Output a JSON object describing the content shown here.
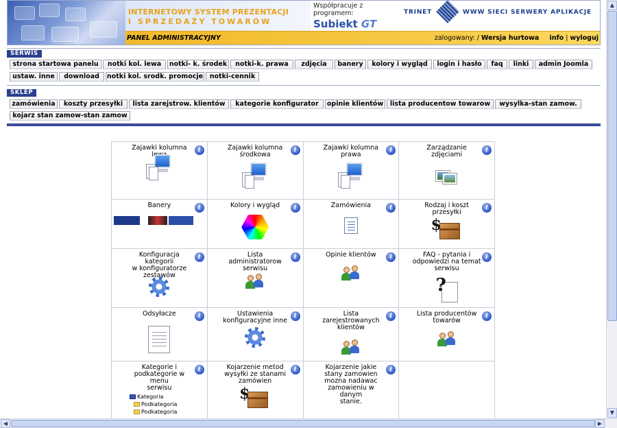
{
  "header": {
    "banner_line1": "INTERNETOWY SYSTEM PREZENTACJI",
    "banner_line2": "I SPRZEDAŻY TOWARÓW",
    "cooperates_line1": "Współpracuje z",
    "cooperates_line2": "programem:",
    "cooperates_logo": "Subiekt",
    "cooperates_logo_suffix": "GT",
    "trinet_left": "TRINET",
    "trinet_right": "WWW SIECI SERWERY APLIKACJE",
    "panel_label": "PANEL ADMINISTRACYJNY",
    "logged_label": "zalogowany: /",
    "logged_user": "Wersja hurtowa",
    "info_link": "info",
    "separator": "|",
    "logout_link": "wyloguj"
  },
  "serwis": {
    "title": "SERWIS",
    "row1": [
      "strona startowa panelu",
      "notki kol. lewa",
      "notki- k. środek",
      "notki-k. prawa",
      "zdjęcia",
      "banery",
      "kolory i wygląd",
      "login i hasło",
      "faq",
      "linki",
      "admin Joomla"
    ],
    "row2": [
      "ustaw. inne",
      "download",
      "notki kol. srodk. promocje",
      "notki-cennik"
    ]
  },
  "sklep": {
    "title": "SKLEP",
    "row1": [
      "zamówienia",
      "koszty przesyłki",
      "lista zarejstrow. klientów",
      "kategorie konfigurator",
      "opinie klientów",
      "lista producentow towarow",
      "wysylka-stan zamow."
    ],
    "row2": [
      "kojarz stan zamow-stan zamow"
    ]
  },
  "grid": {
    "info_glyph": "i",
    "cells": [
      {
        "title": "Zajawki kolumna lewa",
        "icon": "monitor-documents-icon"
      },
      {
        "title": "Zajawki kolumna\nśrodkowa",
        "icon": "monitor-documents-icon"
      },
      {
        "title": "Zajawki kolumna\nprawa",
        "icon": "monitor-documents-icon"
      },
      {
        "title": "Zarządzanie\nzdjęciami",
        "icon": "photos-icon"
      },
      {
        "title": "Banery",
        "icon": "banners-icon"
      },
      {
        "title": "Kolory i wygląd",
        "icon": "color-hexagon-icon"
      },
      {
        "title": "Zamówienia",
        "icon": "document-icon"
      },
      {
        "title": "Rodzaj i koszt\nprzesyłki",
        "icon": "dollar-box-icon"
      },
      {
        "title": "Konfiguracja kategorii\nw konfiguratorze\nzestawów",
        "icon": "gear-icon"
      },
      {
        "title": "Lista administratorow\nserwisu",
        "icon": "users-icon"
      },
      {
        "title": "Opinie klientów",
        "icon": "users-icon"
      },
      {
        "title": "FAQ - pytania i\nodpowiedzi na temat\nserwisu",
        "icon": "question-document-icon"
      },
      {
        "title": "Odsyłacze",
        "icon": "blank-document-icon"
      },
      {
        "title": "Ustawienia\nkonfiguracyjne inne",
        "icon": "gear-icon"
      },
      {
        "title": "Lista\nzarejestrowanych\nklientów",
        "icon": "users-icon"
      },
      {
        "title": "Lista producentów\ntowarów",
        "icon": "users-icon"
      },
      {
        "title": "Kategorie i\npodkategorie w menu\nserwisu",
        "icon": "category-tree-icon"
      },
      {
        "title": "Kojarzenie metod\nwysyłki ze stanami\nzamówien",
        "icon": "dollar-box-icon"
      },
      {
        "title": "Kojarzenie jakie\nstany zamowien\nmozna nadawac\nzamowieniu w danym\nstanie.",
        "icon": ""
      }
    ],
    "tree": {
      "root": "Kategoria",
      "child1": "Podkategoria",
      "child2": "Podkategoria"
    }
  }
}
